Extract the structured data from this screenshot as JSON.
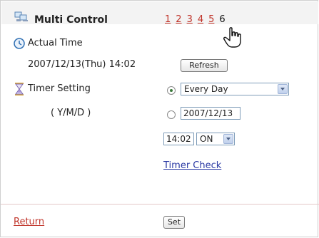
{
  "header": {
    "title": "Multi Control",
    "pages": [
      "1",
      "2",
      "3",
      "4",
      "5"
    ],
    "current_page": "6"
  },
  "actual_time": {
    "label": "Actual Time",
    "value": "2007/12/13(Thu) 14:02",
    "refresh_label": "Refresh"
  },
  "timer": {
    "label": "Timer Setting",
    "date_format": "( Y/M/D )",
    "every_day_option": "Every Day",
    "every_day_selected": true,
    "date_value": "2007/12/13",
    "time_value": "14:02",
    "state_value": "ON",
    "check_link": "Timer Check"
  },
  "footer": {
    "return_label": "Return",
    "set_label": "Set"
  },
  "colors": {
    "link_red": "#c0342a",
    "link_blue": "#2b3aa4",
    "header_bg": "#f3f3f3"
  }
}
